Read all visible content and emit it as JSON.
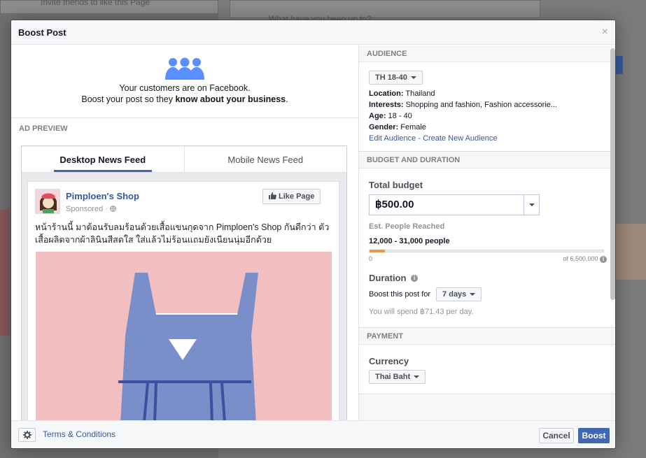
{
  "modal": {
    "title": "Boost Post",
    "close_label": "×"
  },
  "hero": {
    "line1": "Your customers are on Facebook.",
    "line2_prefix": "Boost your post so they ",
    "line2_bold": "know about your business",
    "line2_suffix": "."
  },
  "ad_preview": {
    "section_label": "AD PREVIEW",
    "tabs": [
      {
        "label": "Desktop News Feed",
        "active": true
      },
      {
        "label": "Mobile News Feed",
        "active": false
      }
    ],
    "post": {
      "page_name": "Pimploen's Shop",
      "sponsored_label": "Sponsored · ",
      "like_page_label": "Like Page",
      "text": "หน้าร้านนี้ มาต้อนรับลมร้อนด้วยเสื้อแขนกุดจาก Pimploen's Shop กันดีกว่า ตัวเสื้อผลิตจากผ้าลินินสีสดใส ใส่แล้วไม่ร้อนแถมยังเนียนนุ่มอีกด้วย"
    }
  },
  "audience": {
    "section_label": "AUDIENCE",
    "selector": "TH 18-40",
    "location_label": "Location:",
    "location_value": "Thailand",
    "interests_label": "Interests:",
    "interests_value": "Shopping and fashion, Fashion accessorie...",
    "age_label": "Age:",
    "age_value": "18 - 40",
    "gender_label": "Gender:",
    "gender_value": "Female",
    "edit_link": "Edit Audience",
    "separator": " - ",
    "create_link": "Create New Audience"
  },
  "budget": {
    "section_label": "BUDGET AND DURATION",
    "total_label": "Total budget",
    "total_value": "฿500.00",
    "reach_label": "Est. People Reached",
    "reach_value": "12,000 - 31,000 people",
    "range_min": "0",
    "range_max": "of 6,500,000",
    "reach_fraction": 0.065,
    "duration_label": "Duration",
    "boost_for_label": "Boost this post for",
    "duration_value": "7 days",
    "spend_note": "You will spend ฿71.43 per day."
  },
  "payment": {
    "section_label": "PAYMENT",
    "currency_label": "Currency",
    "currency_value": "Thai Baht"
  },
  "footer": {
    "terms_label": "Terms & Conditions",
    "cancel_label": "Cancel",
    "boost_label": "Boost"
  },
  "background": {
    "line1": "What have you been up to?",
    "line2": "Invite friends to like this Page"
  }
}
